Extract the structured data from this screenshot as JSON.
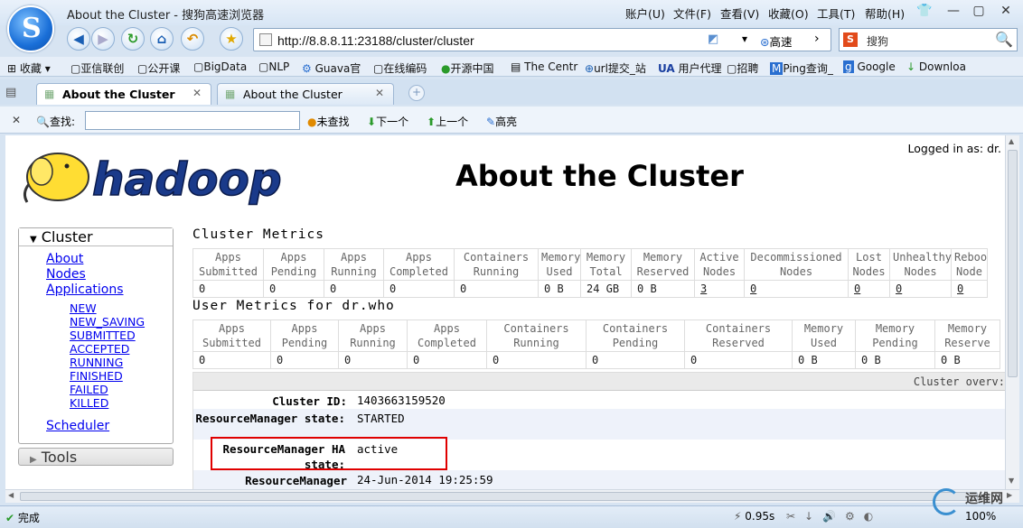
{
  "window": {
    "title": "About the Cluster - 搜狗高速浏览器"
  },
  "menu": [
    "账户(U)",
    "文件(F)",
    "查看(V)",
    "收藏(O)",
    "工具(T)",
    "帮助(H)"
  ],
  "address": {
    "url": "http://8.8.8.11:23188/cluster/cluster",
    "speed_label": "高速"
  },
  "search": {
    "placeholder": "搜狗"
  },
  "bookmarks": [
    "收藏",
    "亚信联创",
    "公开课",
    "BigData",
    "NLP",
    "Guava官",
    "在线编码",
    "开源中国",
    "The Centr",
    "url提交_站",
    "用户代理",
    "招聘",
    "Ping查询_",
    "Google",
    "Downloa"
  ],
  "tabs": [
    {
      "label": "About the Cluster"
    },
    {
      "label": "About the Cluster"
    }
  ],
  "find": {
    "label": "查找:",
    "unfound": "未查找",
    "next": "下一个",
    "prev": "上一个",
    "highlight": "高亮"
  },
  "page": {
    "logged_in": "Logged in as: dr.",
    "logo_text": "hadoop",
    "title": "About the Cluster"
  },
  "sidebar": {
    "header": "Cluster",
    "links": [
      "About",
      "Nodes",
      "Applications"
    ],
    "app_states": [
      "NEW",
      "NEW_SAVING",
      "SUBMITTED",
      "ACCEPTED",
      "RUNNING",
      "FINISHED",
      "FAILED",
      "KILLED"
    ],
    "scheduler": "Scheduler",
    "tools": "Tools"
  },
  "cluster_metrics": {
    "title": "Cluster Metrics",
    "headers": [
      [
        "Apps",
        "Submitted"
      ],
      [
        "Apps",
        "Pending"
      ],
      [
        "Apps",
        "Running"
      ],
      [
        "Apps",
        "Completed"
      ],
      [
        "Containers",
        "Running"
      ],
      [
        "Memory",
        "Used"
      ],
      [
        "Memory",
        "Total"
      ],
      [
        "Memory",
        "Reserved"
      ],
      [
        "Active",
        "Nodes"
      ],
      [
        "Decommissioned",
        "Nodes"
      ],
      [
        "Lost",
        "Nodes"
      ],
      [
        "Unhealthy",
        "Nodes"
      ],
      [
        "Reboo",
        "Node"
      ]
    ],
    "values": [
      "0",
      "0",
      "0",
      "0",
      "0",
      "0 B",
      "24 GB",
      "0 B",
      "3",
      "0",
      "0",
      "0",
      "0"
    ]
  },
  "user_metrics": {
    "title": "User Metrics for dr.who",
    "headers": [
      [
        "Apps",
        "Submitted"
      ],
      [
        "Apps",
        "Pending"
      ],
      [
        "Apps",
        "Running"
      ],
      [
        "Apps",
        "Completed"
      ],
      [
        "Containers",
        "Running"
      ],
      [
        "Containers",
        "Pending"
      ],
      [
        "Containers",
        "Reserved"
      ],
      [
        "Memory",
        "Used"
      ],
      [
        "Memory",
        "Pending"
      ],
      [
        "Memory",
        "Reserve"
      ]
    ],
    "values": [
      "0",
      "0",
      "0",
      "0",
      "0",
      "0",
      "0",
      "0 B",
      "0 B",
      "0 B"
    ]
  },
  "overview": {
    "header": "Cluster overv:",
    "rows": [
      {
        "label": "Cluster ID:",
        "value": "1403663159520"
      },
      {
        "label": "ResourceManager state:",
        "value": "STARTED"
      },
      {
        "label": "ResourceManager HA state:",
        "value": "active"
      },
      {
        "label": "ResourceManager",
        "value": "24-Jun-2014 19:25:59"
      }
    ]
  },
  "status": {
    "text": "完成",
    "time": "0.95s",
    "zoom": "100%"
  },
  "watermark": "运维网"
}
